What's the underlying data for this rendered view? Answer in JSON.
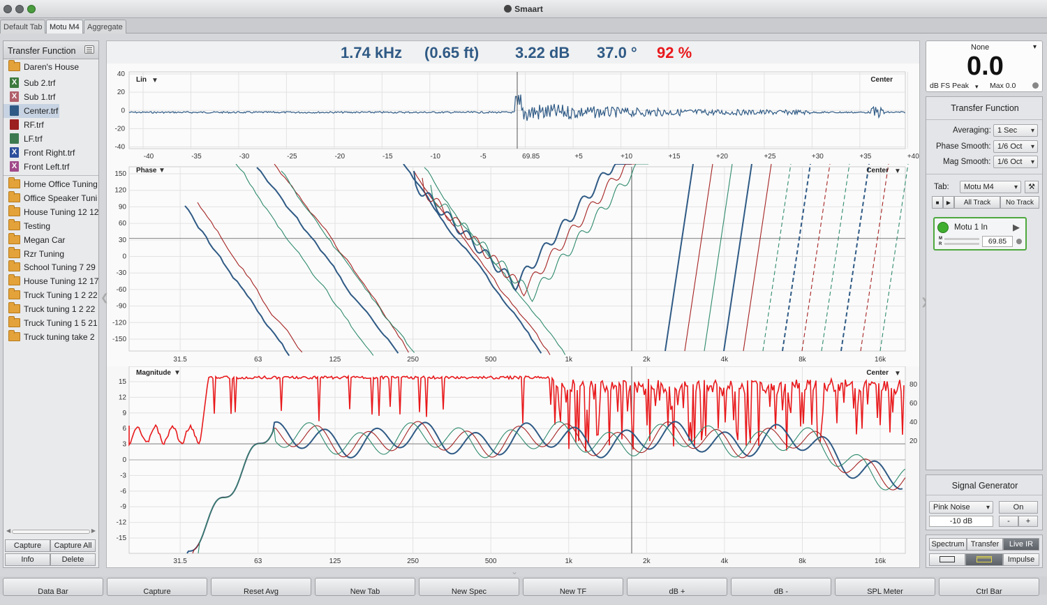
{
  "window": {
    "title": "Smaart"
  },
  "tabs": [
    {
      "label": "Default Tab",
      "active": false
    },
    {
      "label": "Motu M4",
      "active": true
    },
    {
      "label": "Aggregate",
      "active": false
    }
  ],
  "sidebar": {
    "title": "Transfer Function",
    "root_folder": "Daren's House",
    "files": [
      {
        "label": "Sub 2.trf",
        "color": "#3d7a3d",
        "glyph": "X"
      },
      {
        "label": "Sub 1.trf",
        "color": "#b0606a",
        "glyph": "X"
      },
      {
        "label": "Center.trf",
        "color": "#2f5a85",
        "glyph": "",
        "selected": true
      },
      {
        "label": "RF.trf",
        "color": "#9c1f1f",
        "glyph": ""
      },
      {
        "label": "LF.trf",
        "color": "#3d7a50",
        "glyph": ""
      },
      {
        "label": "Front Right.trf",
        "color": "#2c4f9c",
        "glyph": "X"
      },
      {
        "label": "Front Left.trf",
        "color": "#a04a8a",
        "glyph": "X"
      }
    ],
    "folders": [
      "Home Office Tuning",
      "Office Speaker Tuni",
      "House Tuning 12 12",
      "Testing",
      "Megan Car",
      "Rzr Tuning",
      "School Tuning 7 29",
      "House Tuning 12 17",
      "Truck Tuning 1 2 22",
      "Truck tuning 1 2 22",
      "Truck Tuning 1 5 21",
      "Truck tuning take 2"
    ],
    "buttons": {
      "capture": "Capture",
      "capture_all": "Capture All",
      "info": "Info",
      "delete": "Delete"
    }
  },
  "readout": {
    "freq": "1.74 kHz",
    "dist": "(0.65 ft)",
    "db": "3.22 dB",
    "deg": "37.0 °",
    "pct": "92 %"
  },
  "plots": {
    "ir": {
      "label": "Lin",
      "channel": "Center",
      "y_ticks": [
        "40",
        "20",
        "0",
        "-20",
        "-40"
      ],
      "x_ticks": [
        "-40",
        "-35",
        "-30",
        "-25",
        "-20",
        "-15",
        "-10",
        "-5",
        "69.85",
        "+5",
        "+10",
        "+15",
        "+20",
        "+25",
        "+30",
        "+35",
        "+40"
      ]
    },
    "phase": {
      "label": "Phase",
      "channel": "Center",
      "y_ticks": [
        "150",
        "120",
        "90",
        "60",
        "30",
        "0",
        "-30",
        "-60",
        "-90",
        "-120",
        "-150"
      ],
      "x_ticks": [
        "31.5",
        "63",
        "125",
        "250",
        "500",
        "1k",
        "2k",
        "4k",
        "8k",
        "16k"
      ]
    },
    "magnitude": {
      "label": "Magnitude",
      "channel": "Center",
      "y_ticks": [
        "15",
        "12",
        "9",
        "6",
        "3",
        "0",
        "-3",
        "-6",
        "-9",
        "-12",
        "-15"
      ],
      "coh_ticks": [
        "80",
        "60",
        "40",
        "20"
      ],
      "x_ticks": [
        "31.5",
        "63",
        "125",
        "250",
        "500",
        "1k",
        "2k",
        "4k",
        "8k",
        "16k"
      ]
    }
  },
  "chart_data": [
    {
      "type": "line",
      "title": "Lin",
      "xlabel": "",
      "ylabel": "",
      "x": [
        -40,
        -35,
        -30,
        -25,
        -20,
        -15,
        -10,
        -5,
        0,
        5,
        10,
        15,
        20,
        25,
        30,
        35,
        40
      ],
      "ylim": [
        -40,
        40
      ],
      "series": []
    },
    {
      "type": "line",
      "title": "Phase",
      "xlabel": "",
      "ylabel": "",
      "x_scale": "log",
      "xlim": [
        20,
        20000
      ],
      "ylim": [
        -180,
        180
      ],
      "series": []
    },
    {
      "type": "line",
      "title": "Magnitude",
      "xlabel": "",
      "ylabel": "",
      "x_scale": "log",
      "xlim": [
        20,
        20000
      ],
      "ylim": [
        -18,
        18
      ],
      "series": []
    }
  ],
  "meter": {
    "source": "None",
    "value": "0.0",
    "mode": "dB FS Peak",
    "max": "Max 0.0"
  },
  "tf_settings": {
    "title": "Transfer Function",
    "averaging_label": "Averaging:",
    "averaging": "1 Sec",
    "phase_smooth_label": "Phase Smooth:",
    "phase_smooth": "1/6 Oct",
    "mag_smooth_label": "Mag Smooth:",
    "mag_smooth": "1/6 Oct",
    "tab_label": "Tab:",
    "tab": "Motu M4",
    "all_track": "All Track",
    "no_track": "No Track",
    "input_name": "Motu 1 In",
    "m": "M",
    "r": "R",
    "delay": "69.85"
  },
  "signal_gen": {
    "title": "Signal Generator",
    "type": "Pink Noise",
    "on": "On",
    "level": "-10 dB",
    "minus": "-",
    "plus": "+"
  },
  "mode_buttons": {
    "spectrum": "Spectrum",
    "transfer": "Transfer",
    "live_ir": "Live IR",
    "impulse": "Impulse"
  },
  "bottom": [
    "Data Bar",
    "Capture",
    "Reset Avg",
    "New Tab",
    "New Spec",
    "New TF",
    "dB +",
    "dB -",
    "SPL Meter",
    "Ctrl Bar"
  ]
}
